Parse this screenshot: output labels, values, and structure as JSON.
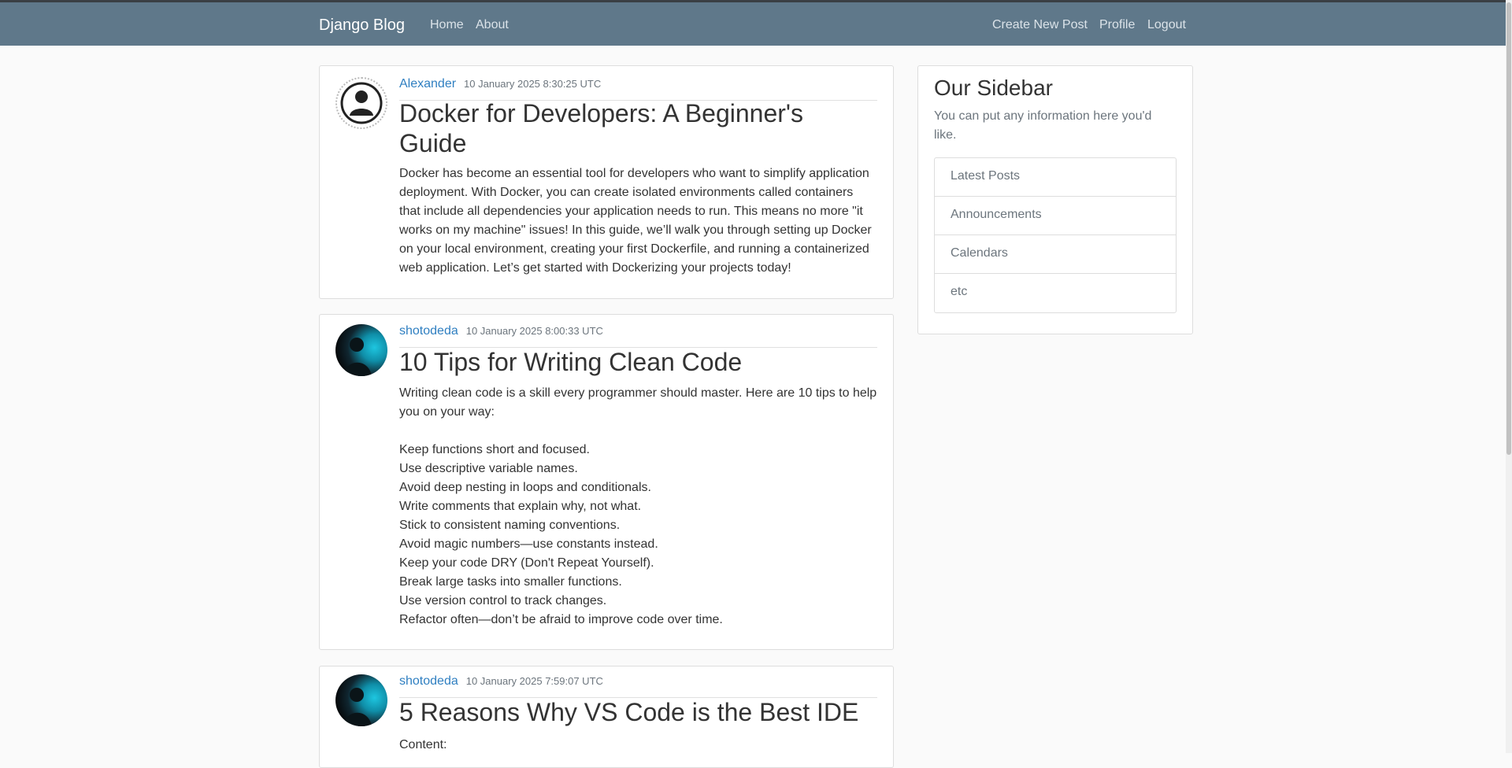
{
  "navbar": {
    "brand": "Django Blog",
    "left_links": [
      "Home",
      "About"
    ],
    "right_links": [
      "Create New Post",
      "Profile",
      "Logout"
    ]
  },
  "posts": [
    {
      "author": "Alexander",
      "date": "10 January 2025 8:30:25 UTC",
      "title": "Docker for Developers: A Beginner's Guide",
      "content": "Docker has become an essential tool for developers who want to simplify application deployment. With Docker, you can create isolated environments called containers that include all dependencies your application needs to run. This means no more \"it works on my machine\" issues! In this guide, we’ll walk you through setting up Docker on your local environment, creating your first Dockerfile, and running a containerized web application. Let’s get started with Dockerizing your projects today!"
    },
    {
      "author": "shotodeda",
      "date": "10 January 2025 8:00:33 UTC",
      "title": "10 Tips for Writing Clean Code",
      "content": "Writing clean code is a skill every programmer should master. Here are 10 tips to help you on your way:\n\nKeep functions short and focused.\nUse descriptive variable names.\nAvoid deep nesting in loops and conditionals.\nWrite comments that explain why, not what.\nStick to consistent naming conventions.\nAvoid magic numbers—use constants instead.\nKeep your code DRY (Don't Repeat Yourself).\nBreak large tasks into smaller functions.\nUse version control to track changes.\nRefactor often—don’t be afraid to improve code over time."
    },
    {
      "author": "shotodeda",
      "date": "10 January 2025 7:59:07 UTC",
      "title": "5 Reasons Why VS Code is the Best IDE",
      "content": "Content:"
    }
  ],
  "sidebar": {
    "title": "Our Sidebar",
    "description": "You can put any information here you'd like.",
    "items": [
      "Latest Posts",
      "Announcements",
      "Calendars",
      "etc"
    ]
  }
}
